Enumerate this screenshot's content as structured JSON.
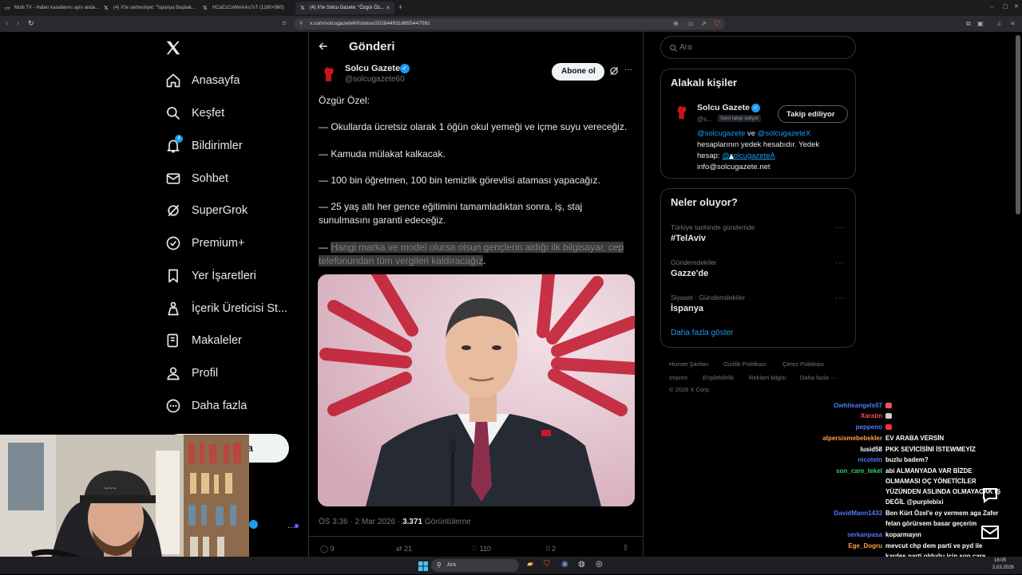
{
  "browser": {
    "tabs": [
      {
        "label": "Multi TV - Haber kanallarını aynı anda...",
        "icon": "tv-icon"
      },
      {
        "label": "(4) X'te serbestiyet: \"İspanya Başbak...",
        "icon": "x-logo-icon"
      },
      {
        "label": "HCaEzCvWwAAs7sT (1280×960)",
        "icon": "image-icon"
      },
      {
        "label": "(4) X'te Solcu Gazete: \"Özgür Öz...",
        "icon": "x-logo-icon"
      }
    ],
    "url": "x.com/solcugazete60/status/2028449318655447091"
  },
  "nav": {
    "items": [
      {
        "label": "Anasayfa",
        "icon": "home-icon"
      },
      {
        "label": "Keşfet",
        "icon": "search-icon"
      },
      {
        "label": "Bildirimler",
        "icon": "bell-icon",
        "badge": "4"
      },
      {
        "label": "Sohbet",
        "icon": "mail-icon"
      },
      {
        "label": "SuperGrok",
        "icon": "grok-icon"
      },
      {
        "label": "Premium+",
        "icon": "verified-icon"
      },
      {
        "label": "Yer İşaretleri",
        "icon": "bookmark-icon"
      },
      {
        "label": "İçerik Üreticisi St...",
        "icon": "creator-icon"
      },
      {
        "label": "Makaleler",
        "icon": "article-icon"
      },
      {
        "label": "Profil",
        "icon": "person-icon"
      },
      {
        "label": "Daha fazla",
        "icon": "more-circle-icon"
      }
    ],
    "post_button": "la"
  },
  "post": {
    "header_title": "Gönderi",
    "author_name": "Solcu Gazete",
    "author_handle": "@solcugazete60",
    "subscribe_label": "Abone ol",
    "paragraphs": [
      "Özgür Özel:",
      "— Okullarda ücretsiz olarak 1 öğün okul yemeği ve içme suyu vereceğiz.",
      "— Kamuda mülakat kalkacak.",
      "— 100 bin öğretmen, 100 bin temizlik görevlisi ataması yapacağız.",
      "— 25 yaş altı her gence eğitimini tamamladıktan sonra, iş, staj sunulmasını garanti edeceğiz."
    ],
    "last_prefix": "— ",
    "last_highlight": "Hangi marka ve model olursa olsun gençlerin aldığı ilk bilgisayar, cep telefonundan tüm vergileri kaldıracağız",
    "last_suffix": ".",
    "meta_time": "ÖS 3:36 · 2 Mar 2026 · ",
    "views_count": "3.371",
    "views_label": " Görüntüleme",
    "replies": "9",
    "reposts": "21",
    "likes": "110",
    "bookmarks": "2"
  },
  "right": {
    "search_placeholder": "Ara",
    "related_title": "Alakalı kişiler",
    "related_name": "Solcu Gazete",
    "related_handle": "@s...",
    "related_follows_you": "Seni takip ediyor",
    "related_button": "Takip ediliyor",
    "bio_link1": "@solcugazete",
    "bio_and": " ve ",
    "bio_link2": "@solcugazeteX",
    "bio_line2": "hesaplarının yedek hesabıdır. Yedek",
    "bio_line3_prefix": "hesap: ",
    "bio_link3": "@solcugazeteA",
    "bio_line4": "info@solcugazete.net",
    "trends_title": "Neler oluyor?",
    "trends": [
      {
        "meta": "Türkiye tarihinde gündemde",
        "name": "#TelAviv"
      },
      {
        "meta": "Gündemdekiler",
        "name": "Gazze'de"
      },
      {
        "meta": "Siyaset · Gündemdekiler",
        "name": "İspanya"
      }
    ],
    "show_more": "Daha fazla göster",
    "footer": [
      "Hizmet Şartları",
      "Gizlilik Politikası",
      "Çerez Politikası",
      "Imprint",
      "Erişilebilirlik",
      "Reklam bilgisi",
      "Daha fazla ···",
      "© 2026 X Corp."
    ]
  },
  "chat": [
    {
      "user": "Owhiteangels07",
      "color": "#4f7bff",
      "msg": ""
    },
    {
      "user": "Xaratm",
      "color": "#ff4b4b",
      "msg": ""
    },
    {
      "user": "peppeno",
      "color": "#4f7bff",
      "msg": ""
    },
    {
      "user": "alpersismebebekler",
      "color": "#ff9f43",
      "msg": "EV ARABA VERSİN"
    },
    {
      "user": "lusid58",
      "color": "#ffffff",
      "msg": "PKK SEVİCİSİNİ İSTEWMEYİZ"
    },
    {
      "user": "nicoteln",
      "color": "#4f7bff",
      "msg": "buzlu badem?"
    },
    {
      "user": "son_care_tekel",
      "color": "#2ecc71",
      "msg": "abi ALMANYADA VAR BİZDE"
    },
    {
      "user": "",
      "color": "#ffffff",
      "msg": "OLMAMASI OÇ YÖNETİCİLER"
    },
    {
      "user": "",
      "color": "#ffffff",
      "msg": "YÜZÜNDEN ASLINDA OLMAYACAK İŞ"
    },
    {
      "user": "",
      "color": "#ffffff",
      "msg": "DEĞİL @purplebixi"
    },
    {
      "user": "DavidMann1433",
      "color": "#4f7bff",
      "msg": "Ben Kürt Özel'e oy vermem aga Zafer"
    },
    {
      "user": "",
      "color": "#ffffff",
      "msg": "felan görürsem basar geçerim"
    },
    {
      "user": "serkanpasa",
      "color": "#4f7bff",
      "msg": "koparmayın"
    },
    {
      "user": "Ege_Dogru",
      "color": "#ff9f43",
      "msg": "mevcut chp dem parti ve pyd ile"
    },
    {
      "user": "",
      "color": "#ffffff",
      "msg": "kardeş parti olduğu için son çare"
    },
    {
      "user": "",
      "color": "#ffffff",
      "msg": "olmadıkça oy verilmez"
    }
  ],
  "taskbar": {
    "search_placeholder": "Ara",
    "time": "16:05",
    "date": "2.03.2026"
  }
}
